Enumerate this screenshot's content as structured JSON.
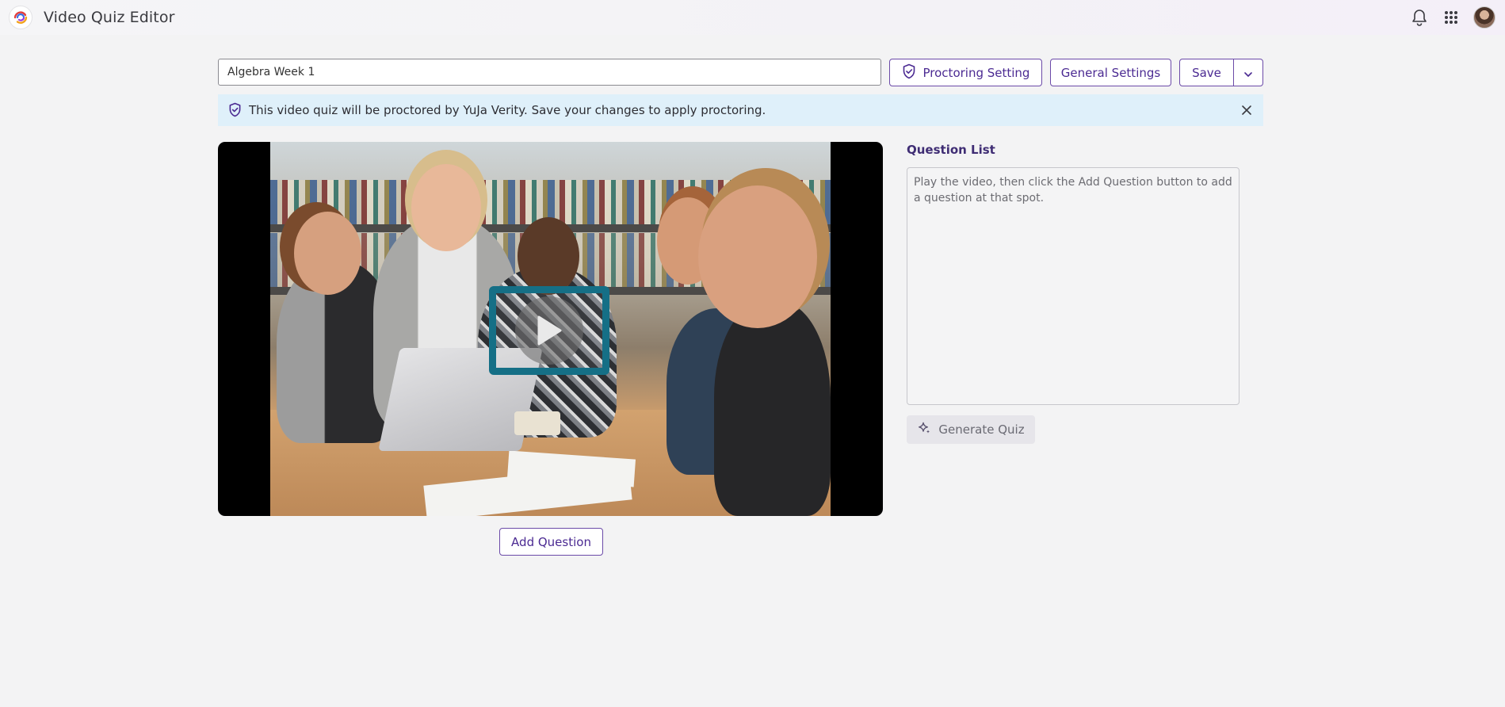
{
  "header": {
    "app_title": "Video Quiz Editor",
    "icons": [
      "app-logo-icon",
      "bell-icon",
      "apps-grid-icon",
      "user-avatar"
    ]
  },
  "toolbar": {
    "quiz_title_value": "Algebra Week 1",
    "proctoring_label": "Proctoring Setting",
    "general_settings_label": "General Settings",
    "save_label": "Save"
  },
  "banner": {
    "message": "This video quiz will be proctored by YuJa Verity. Save your changes to apply proctoring."
  },
  "video": {
    "add_question_label": "Add Question"
  },
  "question_list": {
    "title": "Question List",
    "empty_message": "Play the video, then click the Add Question button to add a question at that spot.",
    "generate_label": "Generate Quiz"
  },
  "colors": {
    "accent": "#4b2a92",
    "banner_bg": "#dff0fa",
    "play_frame": "#156f86",
    "page_bg": "#f3f3f4"
  }
}
